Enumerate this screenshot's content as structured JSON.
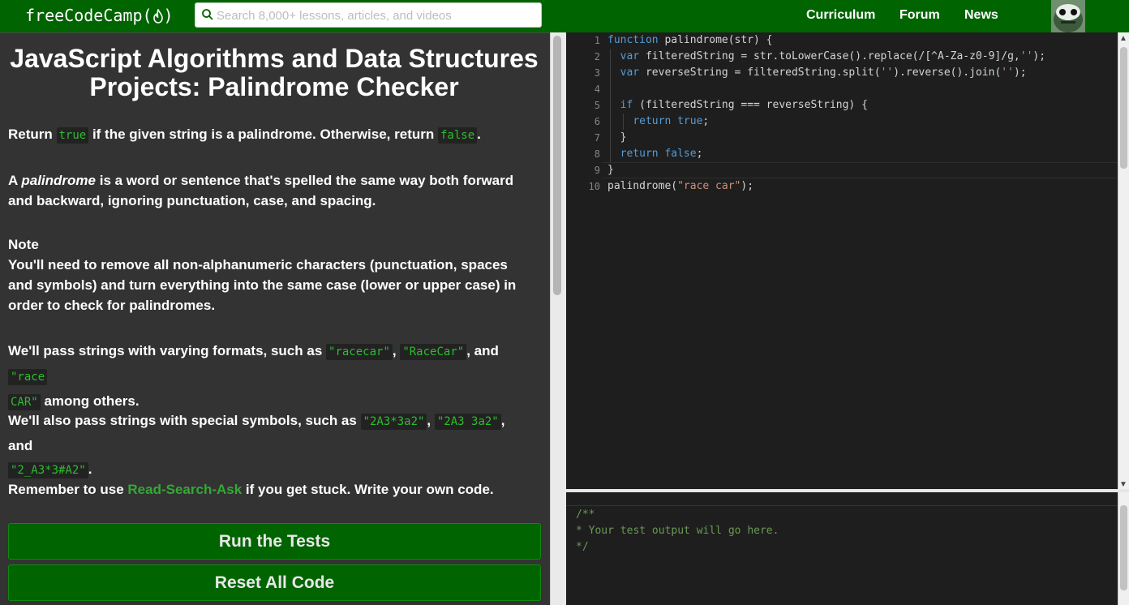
{
  "nav": {
    "brand": "freeCodeCamp(",
    "brand_close": ")",
    "search_placeholder": "Search 8,000+ lessons, articles, and videos",
    "links": [
      "Curriculum",
      "Forum",
      "News"
    ],
    "icons": [
      "flame-icon",
      "search-icon",
      "avatar"
    ]
  },
  "challenge": {
    "title": "JavaScript Algorithms and Data Structures Projects: Palindrome Checker",
    "p1": {
      "a": "Return ",
      "code1": "true",
      "b": " if the given string is a palindrome. Otherwise, return ",
      "code2": "false",
      "c": "."
    },
    "p2": {
      "a": "A ",
      "em": "palindrome",
      "b": " is a word or sentence that's spelled the same way both forward and backward, ignoring punctuation, case, and spacing."
    },
    "note": {
      "heading": "Note",
      "a": "You'll need to remove ",
      "bold": "all non-alphanumeric characters",
      "b": " (punctuation, spaces and symbols) and turn everything into the same case (lower or upper case) in order to check for palindromes."
    },
    "p3": {
      "a": "We'll pass strings with varying formats, such as ",
      "code1": "\"racecar\"",
      "sep1": ", ",
      "code2": "\"RaceCar\"",
      "sep2": ", and ",
      "code3a": "\"race",
      "code3b": "CAR\"",
      "b": " among others."
    },
    "p4": {
      "a": "We'll also pass strings with special symbols, such as ",
      "code1": "\"2A3*3a2\"",
      "sep1": ", ",
      "code2": "\"2A3 3a2\"",
      "sep2": ", and",
      "code3": "\"2_A3*3#A2\"",
      "b": "."
    },
    "p5": {
      "a": "Remember to use ",
      "link": "Read-Search-Ask",
      "b": " if you get stuck. Write your own code."
    }
  },
  "buttons": {
    "run": "Run the Tests",
    "reset": "Reset All Code"
  },
  "editor": {
    "lines": [
      "function palindrome(str) {",
      "  var filteredString = str.toLowerCase().replace(/[^A-Za-z0-9]/g,'');",
      "  var reverseString = filteredString.split('').reverse().join('');",
      "",
      "  if (filteredString === reverseString) {",
      "    return true;",
      "  }",
      "  return false;",
      "}",
      "palindrome(\"race car\");"
    ]
  },
  "output": {
    "lines": [
      "/**",
      "* Your test output will go here.",
      "*/"
    ]
  },
  "colors": {
    "nav": "#006400",
    "accent": "#2cbe2c",
    "link": "#35a835"
  }
}
